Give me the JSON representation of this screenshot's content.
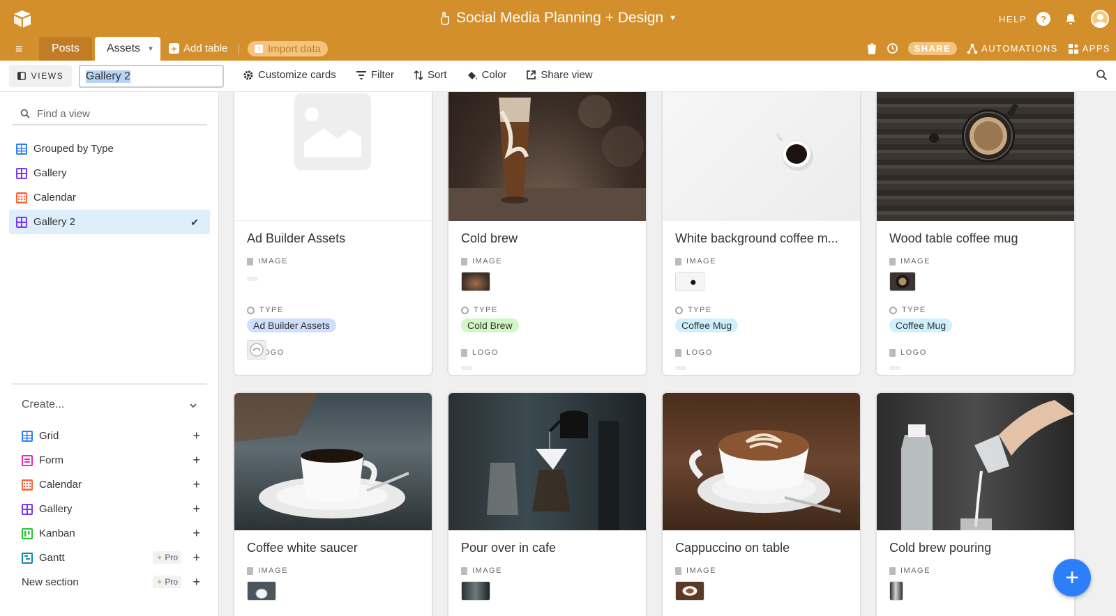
{
  "header": {
    "base_title": "Social Media Planning + Design",
    "help_label": "HELP",
    "help_icon_glyph": "?"
  },
  "tabs": {
    "items": [
      {
        "label": "Posts"
      },
      {
        "label": "Assets"
      }
    ],
    "add_table_label": "Add table",
    "import_label": "Import data",
    "share_label": "SHARE",
    "automations_label": "AUTOMATIONS",
    "apps_label": "APPS"
  },
  "viewbar": {
    "views_label": "VIEWS",
    "view_name_value": "Gallery 2",
    "tools": [
      {
        "label": "Customize cards",
        "icon": "gear-icon"
      },
      {
        "label": "Filter",
        "icon": "filter-icon"
      },
      {
        "label": "Sort",
        "icon": "sort-icon"
      },
      {
        "label": "Color",
        "icon": "paint-bucket-icon"
      },
      {
        "label": "Share view",
        "icon": "share-icon"
      }
    ]
  },
  "sidebar": {
    "find_placeholder": "Find a view",
    "views": [
      {
        "label": "Grouped by Type",
        "icon": "grid"
      },
      {
        "label": "Gallery",
        "icon": "gallery"
      },
      {
        "label": "Calendar",
        "icon": "calendar"
      },
      {
        "label": "Gallery 2",
        "icon": "gallery",
        "active": true
      }
    ],
    "create_label": "Create...",
    "create_items": [
      {
        "label": "Grid",
        "icon": "grid"
      },
      {
        "label": "Form",
        "icon": "form"
      },
      {
        "label": "Calendar",
        "icon": "calendar"
      },
      {
        "label": "Gallery",
        "icon": "gallery"
      },
      {
        "label": "Kanban",
        "icon": "kanban"
      },
      {
        "label": "Gantt",
        "icon": "gantt",
        "pro": "Pro"
      }
    ],
    "new_section_label": "New section",
    "new_section_pro": "Pro"
  },
  "field_labels": {
    "image": "IMAGE",
    "type": "TYPE",
    "logo": "LOGO"
  },
  "cards": [
    {
      "title": "Ad Builder Assets",
      "type": "Ad Builder Assets",
      "type_color": "#cfdfff",
      "has_image": false,
      "has_logo": true,
      "image_kind": "placeholder"
    },
    {
      "title": "Cold brew",
      "type": "Cold Brew",
      "type_color": "#d1f7c4",
      "has_image": true,
      "has_logo": false,
      "image_kind": "iced"
    },
    {
      "title": "White background coffee m...",
      "type": "Coffee Mug",
      "type_color": "#d0f0fd",
      "has_image": true,
      "has_logo": false,
      "image_kind": "white"
    },
    {
      "title": "Wood table coffee mug",
      "type": "Coffee Mug",
      "type_color": "#d0f0fd",
      "has_image": true,
      "has_logo": false,
      "image_kind": "wood"
    },
    {
      "title": "Coffee white saucer",
      "image_kind": "saucer"
    },
    {
      "title": "Pour over in cafe",
      "image_kind": "pourover"
    },
    {
      "title": "Cappuccino on table",
      "image_kind": "cappuccino"
    },
    {
      "title": "Cold brew pouring",
      "image_kind": "pouring"
    }
  ],
  "fab_label": "+"
}
